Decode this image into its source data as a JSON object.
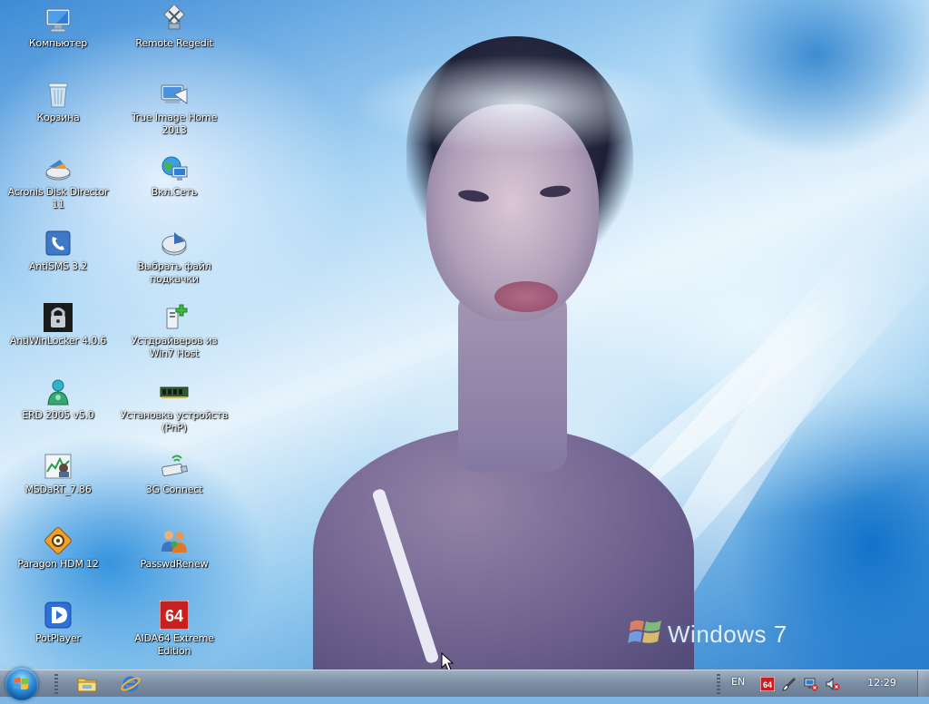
{
  "desktop": {
    "icons": [
      {
        "label": "Компьютер"
      },
      {
        "label": "Remote Regedit"
      },
      {
        "label": "Корзина"
      },
      {
        "label": "True Image Home 2013"
      },
      {
        "label": "Acronis Disk Director 11"
      },
      {
        "label": "Вкл.Сеть"
      },
      {
        "label": "AntiSMS 3.2"
      },
      {
        "label": "Выбрать файл подкачки"
      },
      {
        "label": "AntiWinLocker 4.0.6"
      },
      {
        "label": "Устдрайверов из Win7 Host"
      },
      {
        "label": "ERD 2005 v5.0"
      },
      {
        "label": "Установка устройств (PnP)"
      },
      {
        "label": "MSDaRT_7.86"
      },
      {
        "label": "3G Connect"
      },
      {
        "label": "Paragon HDM 12"
      },
      {
        "label": "PasswdRenew"
      },
      {
        "label": "PotPlayer"
      },
      {
        "label": "AIDA64 Extreme Edition"
      }
    ],
    "wallpaper_brand": "Windows 7"
  },
  "taskbar": {
    "start_icon": "windows-orb",
    "pinned": [
      "folder-icon",
      "internet-explorer-icon"
    ],
    "tray": {
      "language": "EN",
      "icons": [
        "aida64-icon",
        "brush-icon",
        "network-icon",
        "volume-muted-icon"
      ],
      "clock": "12:29"
    }
  },
  "colors": {
    "taskbar": "#7d90a5",
    "start_orb": "#2d8ad8",
    "aida_red": "#c8201e"
  }
}
